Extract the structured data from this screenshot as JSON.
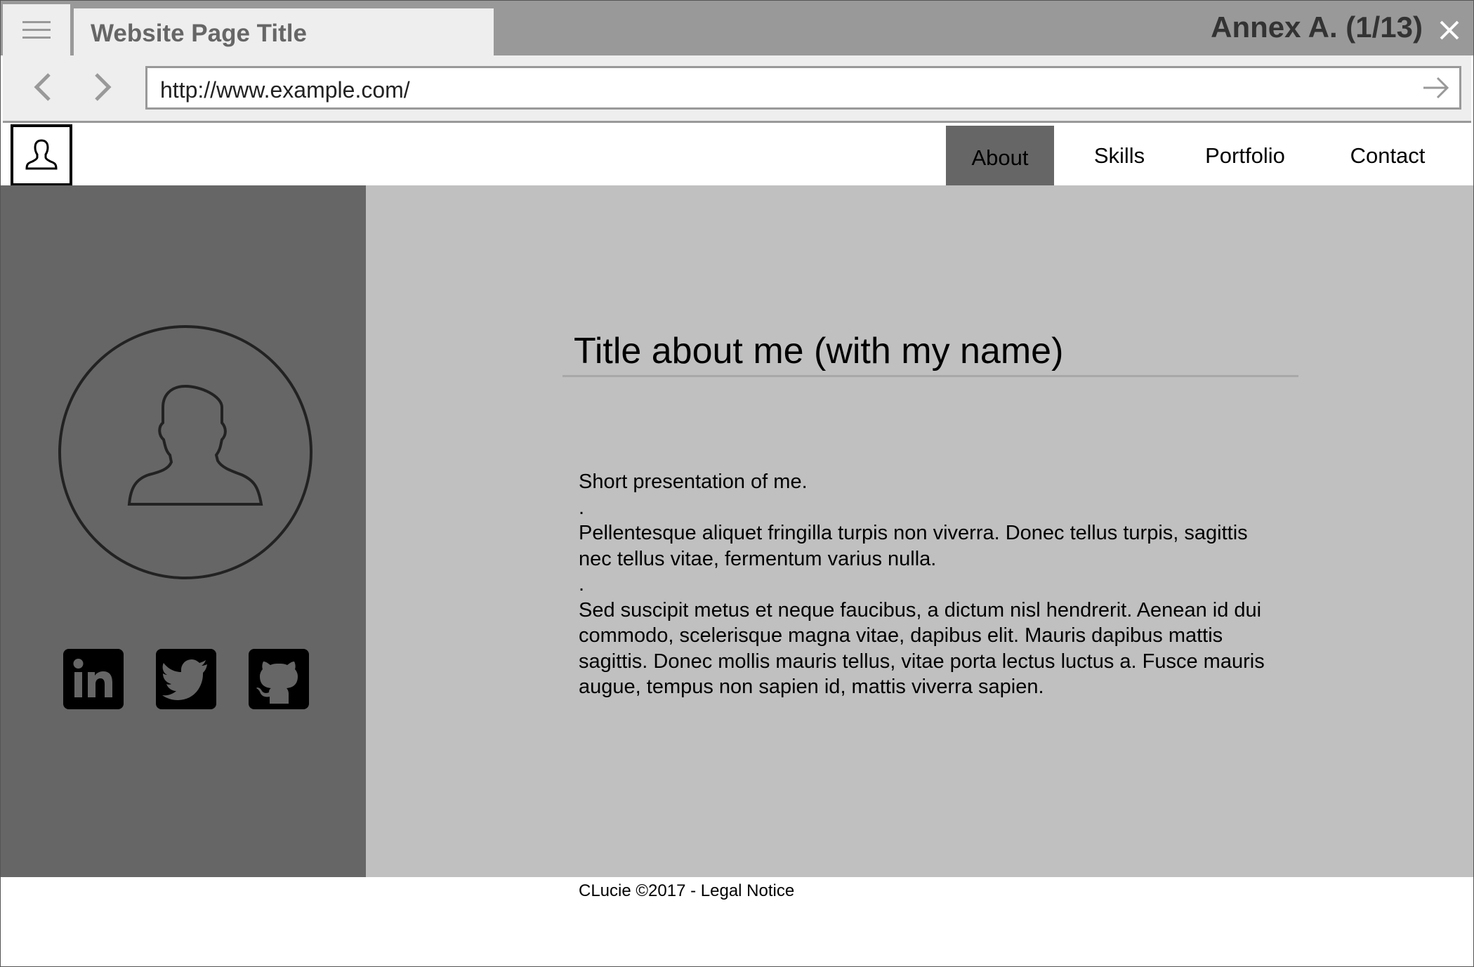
{
  "browser": {
    "tab_title": "Website Page Title",
    "annex_label": "Annex A. (1/13)",
    "url": "http://www.example.com/"
  },
  "site": {
    "nav": [
      {
        "label": "About",
        "active": true
      },
      {
        "label": "Skills",
        "active": false
      },
      {
        "label": "Portfolio",
        "active": false
      },
      {
        "label": "Contact",
        "active": false
      }
    ]
  },
  "sidebar": {
    "socials": [
      "linkedin-icon",
      "twitter-icon",
      "github-icon"
    ]
  },
  "main": {
    "title": "Title about me (with my name)",
    "lines": [
      "Short presentation of me.",
      ".",
      "Pellentesque aliquet fringilla turpis non viverra. Donec tellus turpis, sagittis nec tellus vitae, fermentum varius nulla.",
      ".",
      "Sed suscipit metus et neque faucibus, a dictum nisl hendrerit. Aenean id dui commodo, scelerisque magna vitae, dapibus elit. Mauris dapibus mattis sagittis. Donec mollis mauris tellus, vitae porta lectus luctus a. Fusce mauris augue, tempus non sapien id, mattis viverra sapien."
    ]
  },
  "footer": {
    "text": "CLucie ©2017 - Legal Notice"
  },
  "colors": {
    "titlebar": "#999999",
    "tab": "#eeeeee",
    "sidebar": "#666666",
    "main_bg": "#c0c0c0",
    "nav_active": "#666666"
  }
}
